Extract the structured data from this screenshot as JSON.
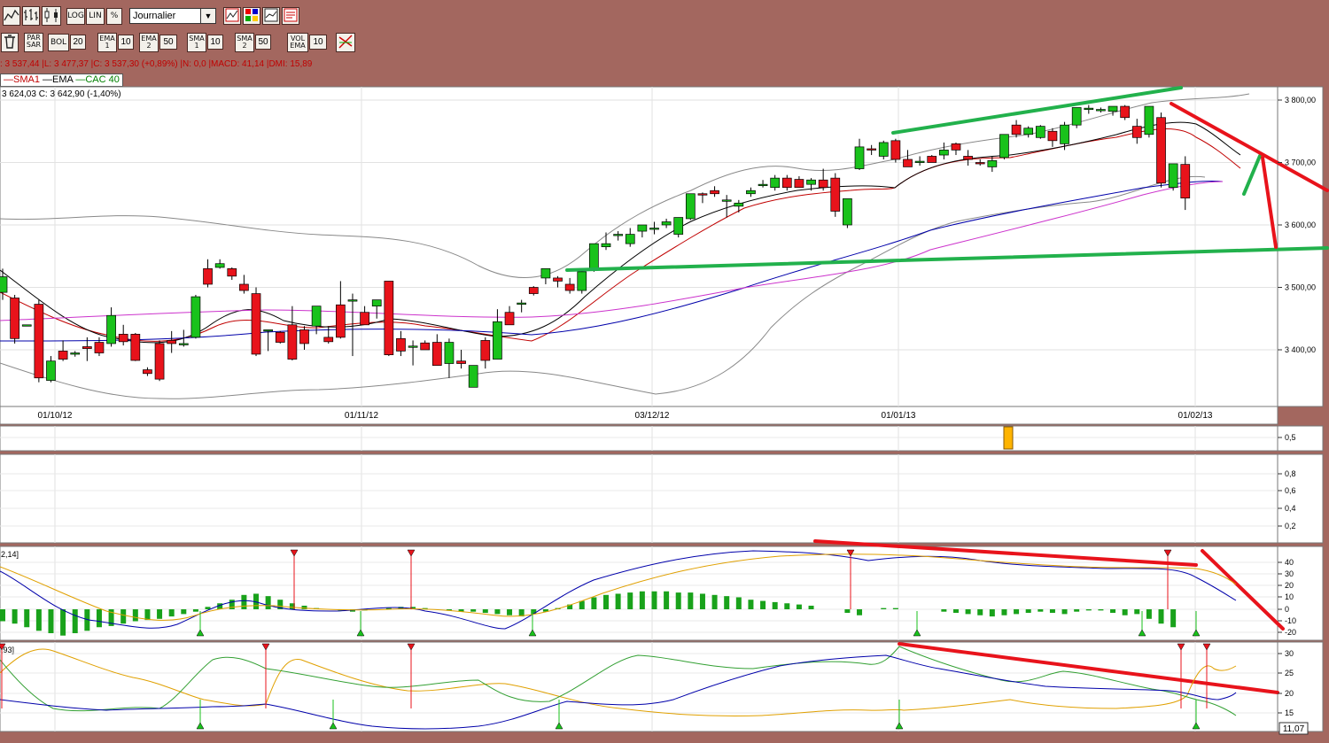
{
  "toolbar1": {
    "scale_buttons": [
      "LOG",
      "LIN",
      "%"
    ],
    "period_select": "Journalier"
  },
  "toolbar2": {
    "indicators": [
      {
        "label": "BOL",
        "value": "20"
      },
      {
        "label": "EMA 1",
        "value": "10"
      },
      {
        "label": "EMA 2",
        "value": "50"
      },
      {
        "label": "SMA 1",
        "value": "10"
      },
      {
        "label": "SMA 2",
        "value": "50"
      },
      {
        "label": "VOL EMA",
        "value": "10"
      }
    ],
    "par_sar": "PAR SAR"
  },
  "info_line": ": 3 537,44 |L: 3 477,37 |C: 3 537,30 (+0,89%) |N: 0,0 |MACD: 41,14 |DMI: 15,89",
  "legend": {
    "sma": "SMA1",
    "ema": "EMA",
    "index": "CAC 40"
  },
  "price_header": "3 624,03  C: 3 642,90  (-1,40%)",
  "macd_header": "2,14]",
  "dmi_header": ",93]",
  "corner_value": "11,07",
  "colors": {
    "up": "#19c21b",
    "down": "#e8131b",
    "frame": "#a3675f",
    "sma": "#c00000",
    "ema": "#000000",
    "index_legend": "#008000"
  },
  "chart_data": [
    {
      "type": "candlestick",
      "x_labels": [
        "01/10/12",
        "01/11/12",
        "03/12/12",
        "01/01/13",
        "01/02/13"
      ],
      "y_ticks": [
        "3 400,00",
        "3 500,00",
        "3 600,00",
        "3 700,00",
        "3 800,00"
      ],
      "ylim": [
        3300,
        3820
      ],
      "candles": [
        [
          3492,
          3530,
          3480,
          3517
        ],
        [
          3483,
          3488,
          3410,
          3418
        ],
        [
          3440,
          3440,
          3440,
          3440
        ],
        [
          3473,
          3480,
          3348,
          3355
        ],
        [
          3351,
          3390,
          3348,
          3382
        ],
        [
          3398,
          3415,
          3382,
          3385
        ],
        [
          3393,
          3398,
          3389,
          3395
        ],
        [
          3405,
          3420,
          3382,
          3402
        ],
        [
          3412,
          3420,
          3390,
          3395
        ],
        [
          3410,
          3468,
          3405,
          3455
        ],
        [
          3425,
          3440,
          3407,
          3413
        ],
        [
          3425,
          3427,
          3382,
          3383
        ],
        [
          3368,
          3372,
          3358,
          3362
        ],
        [
          3410,
          3415,
          3350,
          3353
        ],
        [
          3415,
          3430,
          3395,
          3410
        ],
        [
          3410,
          3432,
          3405,
          3410
        ],
        [
          3420,
          3488,
          3418,
          3485
        ],
        [
          3530,
          3545,
          3500,
          3505
        ],
        [
          3532,
          3545,
          3530,
          3538
        ],
        [
          3530,
          3532,
          3512,
          3518
        ],
        [
          3505,
          3520,
          3490,
          3495
        ],
        [
          3490,
          3500,
          3390,
          3393
        ],
        [
          3432,
          3432,
          3398,
          3432
        ],
        [
          3428,
          3430,
          3410,
          3412
        ],
        [
          3440,
          3470,
          3383,
          3385
        ],
        [
          3432,
          3438,
          3400,
          3410
        ],
        [
          3438,
          3470,
          3425,
          3470
        ],
        [
          3420,
          3438,
          3410,
          3413
        ],
        [
          3472,
          3510,
          3418,
          3420
        ],
        [
          3478,
          3490,
          3390,
          3480
        ],
        [
          3460,
          3470,
          3440,
          3440
        ],
        [
          3470,
          3480,
          3450,
          3480
        ],
        [
          3510,
          3510,
          3390,
          3392
        ],
        [
          3418,
          3430,
          3390,
          3398
        ],
        [
          3406,
          3415,
          3375,
          3406
        ],
        [
          3411,
          3415,
          3400,
          3400
        ],
        [
          3412,
          3425,
          3375,
          3375
        ],
        [
          3378,
          3418,
          3355,
          3412
        ],
        [
          3382,
          3400,
          3370,
          3378
        ],
        [
          3340,
          3375,
          3340,
          3375
        ],
        [
          3415,
          3420,
          3370,
          3383
        ],
        [
          3385,
          3465,
          3385,
          3445
        ],
        [
          3460,
          3470,
          3440,
          3440
        ],
        [
          3475,
          3480,
          3460,
          3475
        ],
        [
          3500,
          3502,
          3487,
          3490
        ],
        [
          3515,
          3530,
          3505,
          3530
        ],
        [
          3515,
          3518,
          3500,
          3510
        ],
        [
          3505,
          3515,
          3490,
          3495
        ],
        [
          3495,
          3530,
          3490,
          3525
        ],
        [
          3530,
          3570,
          3525,
          3570
        ],
        [
          3565,
          3588,
          3560,
          3570
        ],
        [
          3585,
          3590,
          3575,
          3585
        ],
        [
          3570,
          3595,
          3565,
          3585
        ],
        [
          3590,
          3600,
          3580,
          3600
        ],
        [
          3595,
          3605,
          3585,
          3595
        ],
        [
          3600,
          3610,
          3595,
          3605
        ],
        [
          3585,
          3612,
          3580,
          3612
        ],
        [
          3610,
          3650,
          3608,
          3650
        ],
        [
          3650,
          3652,
          3635,
          3648
        ],
        [
          3655,
          3662,
          3645,
          3650
        ],
        [
          3640,
          3648,
          3612,
          3640
        ],
        [
          3630,
          3640,
          3620,
          3635
        ],
        [
          3650,
          3660,
          3645,
          3655
        ],
        [
          3665,
          3672,
          3660,
          3665
        ],
        [
          3660,
          3680,
          3655,
          3675
        ],
        [
          3675,
          3680,
          3655,
          3660
        ],
        [
          3673,
          3678,
          3660,
          3660
        ],
        [
          3665,
          3675,
          3655,
          3672
        ],
        [
          3672,
          3690,
          3655,
          3660
        ],
        [
          3675,
          3683,
          3613,
          3622
        ],
        [
          3600,
          3620,
          3595,
          3642
        ],
        [
          3690,
          3738,
          3688,
          3725
        ],
        [
          3722,
          3728,
          3712,
          3720
        ],
        [
          3710,
          3735,
          3705,
          3732
        ],
        [
          3735,
          3738,
          3700,
          3705
        ],
        [
          3705,
          3720,
          3695,
          3693
        ],
        [
          3700,
          3710,
          3695,
          3702
        ],
        [
          3710,
          3712,
          3700,
          3700
        ],
        [
          3712,
          3732,
          3705,
          3720
        ],
        [
          3730,
          3732,
          3712,
          3720
        ],
        [
          3710,
          3720,
          3695,
          3705
        ],
        [
          3700,
          3705,
          3695,
          3698
        ],
        [
          3693,
          3710,
          3685,
          3703
        ],
        [
          3708,
          3745,
          3705,
          3745
        ],
        [
          3760,
          3768,
          3740,
          3745
        ],
        [
          3745,
          3758,
          3740,
          3755
        ],
        [
          3740,
          3760,
          3738,
          3758
        ],
        [
          3750,
          3755,
          3725,
          3735
        ],
        [
          3730,
          3765,
          3720,
          3760
        ],
        [
          3760,
          3788,
          3755,
          3788
        ],
        [
          3785,
          3792,
          3778,
          3787
        ],
        [
          3785,
          3788,
          3780,
          3785
        ],
        [
          3782,
          3790,
          3775,
          3790
        ],
        [
          3790,
          3792,
          3768,
          3772
        ],
        [
          3758,
          3770,
          3730,
          3740
        ],
        [
          3745,
          3790,
          3740,
          3790
        ],
        [
          3772,
          3780,
          3660,
          3667
        ],
        [
          3660,
          3680,
          3655,
          3698
        ],
        [
          3697,
          3710,
          3624,
          3643
        ]
      ]
    },
    {
      "type": "bar",
      "y_ticks": [
        "0,5"
      ],
      "values_note": "single volume bar"
    },
    {
      "type": "line",
      "y_ticks": [
        "0,2",
        "0,4",
        "0,6",
        "0,8"
      ]
    },
    {
      "type": "macd",
      "y_ticks": [
        "40",
        "30",
        "20",
        "10",
        "0",
        "-10",
        "-20"
      ]
    },
    {
      "type": "dmi",
      "y_ticks": [
        "30",
        "25",
        "20",
        "15"
      ]
    }
  ]
}
